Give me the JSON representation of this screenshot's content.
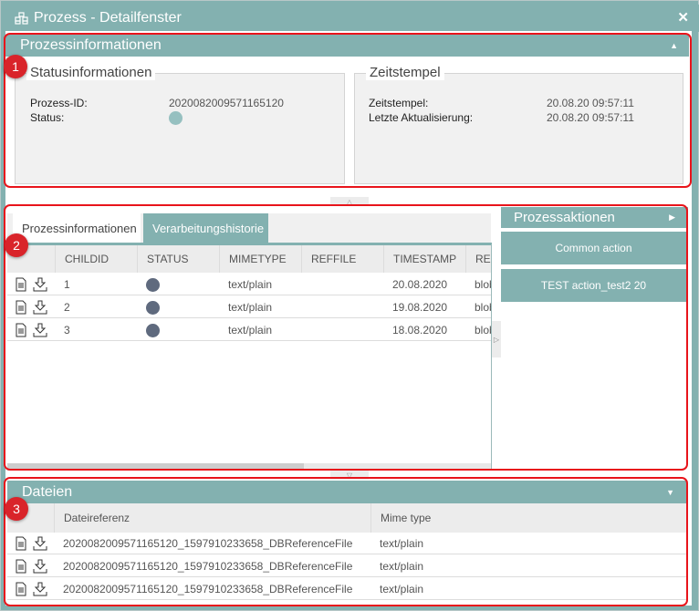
{
  "window": {
    "title": "Prozess - Detailfenster",
    "close_glyph": "✕",
    "app_icon": "process-network-icon"
  },
  "section1": {
    "title": "Prozessinformationen",
    "collapse_glyph": "⏶",
    "status_box": {
      "legend": "Statusinformationen",
      "process_id_label": "Prozess-ID:",
      "process_id_value": "2020082009571165120",
      "status_label": "Status:",
      "status_color": "#96c0c0"
    },
    "time_box": {
      "legend": "Zeitstempel",
      "timestamp_label": "Zeitstempel:",
      "timestamp_value": "20.08.20 09:57:11",
      "last_update_label": "Letzte Aktualisierung:",
      "last_update_value": "20.08.20 09:57:11"
    }
  },
  "section2": {
    "tabs": [
      {
        "label": "Prozessinformationen",
        "active": false
      },
      {
        "label": "Verarbeitungshistorie",
        "active": true
      }
    ],
    "columns": [
      "CHILDID",
      "STATUS",
      "MIMETYPE",
      "REFFILE",
      "TIMESTAMP",
      "REF"
    ],
    "rows": [
      {
        "childid": "1",
        "status_color": "#5f6a7e",
        "mimetype": "text/plain",
        "reffile": "",
        "timestamp": "20.08.2020",
        "ref": "blob"
      },
      {
        "childid": "2",
        "status_color": "#5f6a7e",
        "mimetype": "text/plain",
        "reffile": "",
        "timestamp": "19.08.2020",
        "ref": "blob"
      },
      {
        "childid": "3",
        "status_color": "#5f6a7e",
        "mimetype": "text/plain",
        "reffile": "",
        "timestamp": "18.08.2020",
        "ref": "blob"
      }
    ],
    "actions": {
      "title": "Prozessaktionen",
      "expand_glyph": "▶",
      "buttons": [
        "Common action",
        "TEST action_test2 20"
      ]
    }
  },
  "section3": {
    "title": "Dateien",
    "collapse_glyph": "▼",
    "columns": [
      "Dateireferenz",
      "Mime type"
    ],
    "rows": [
      {
        "reference": "2020082009571165120_1597910233658_DBReferenceFile",
        "mime": "text/plain"
      },
      {
        "reference": "2020082009571165120_1597910233658_DBReferenceFile",
        "mime": "text/plain"
      },
      {
        "reference": "2020082009571165120_1597910233658_DBReferenceFile",
        "mime": "text/plain"
      }
    ]
  },
  "annotations": [
    "1",
    "2",
    "3"
  ],
  "colors": {
    "accent": "#83b1b0",
    "annotation": "#e8141b"
  }
}
